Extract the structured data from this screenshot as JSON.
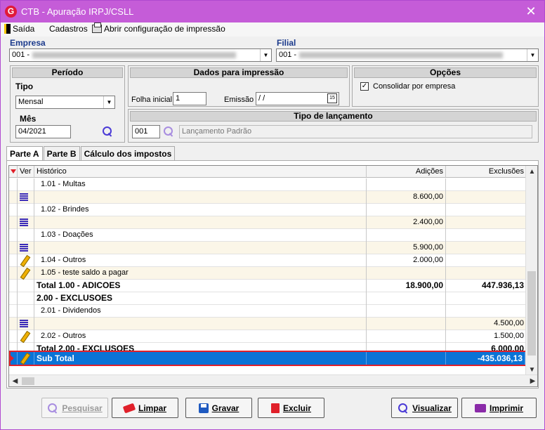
{
  "window": {
    "title": "CTB - Apuração IRPJ/CSLL",
    "app_icon": "G",
    "close_glyph": "✕"
  },
  "menu": {
    "exit": "Saída",
    "registrations": "Cadastros",
    "print_config": "Abrir configuração de impressão"
  },
  "company": {
    "label": "Empresa",
    "value": "001 -"
  },
  "branch": {
    "label": "Filial",
    "value": "001 -"
  },
  "period": {
    "header": "Período",
    "type_label": "Tipo",
    "type_value": "Mensal",
    "month_label": "Mês",
    "month_value": "04/2021"
  },
  "print_data": {
    "header": "Dados para impressão",
    "initial_sheet_label": "Folha inicial",
    "initial_sheet_value": "1",
    "issue_label": "Emissão",
    "issue_value": " / /",
    "calendar_glyph": "15"
  },
  "options": {
    "header": "Opções",
    "consolidate_label": "Consolidar por empresa",
    "consolidate_checked": true,
    "check_glyph": "✓"
  },
  "entry_type": {
    "header": "Tipo de lançamento",
    "code": "001",
    "description": "Lançamento Padrão"
  },
  "tabs": [
    {
      "label": "Parte A",
      "active": true
    },
    {
      "label": "Parte B",
      "active": false
    },
    {
      "label": "Cálculo dos impostos",
      "active": false
    }
  ],
  "grid": {
    "columns": {
      "view": "Ver",
      "history": "Histórico",
      "additions": "Adições",
      "exclusions": "Exclusões"
    },
    "rows": [
      {
        "icon": "",
        "history": "1.01 - Multas",
        "additions": "",
        "exclusions": "",
        "style": "normal"
      },
      {
        "icon": "list-icon",
        "history": "",
        "additions": "8.600,00",
        "exclusions": "",
        "style": "alt"
      },
      {
        "icon": "",
        "history": "1.02 - Brindes",
        "additions": "",
        "exclusions": "",
        "style": "normal"
      },
      {
        "icon": "list-icon",
        "history": "",
        "additions": "2.400,00",
        "exclusions": "",
        "style": "alt"
      },
      {
        "icon": "",
        "history": "1.03 - Doações",
        "additions": "",
        "exclusions": "",
        "style": "normal"
      },
      {
        "icon": "list-icon",
        "history": "",
        "additions": "5.900,00",
        "exclusions": "",
        "style": "alt"
      },
      {
        "icon": "pencil-icon",
        "history": "1.04 - Outros",
        "additions": "2.000,00",
        "exclusions": "",
        "style": "normal"
      },
      {
        "icon": "pencil-icon",
        "history": "1.05 - teste saldo a pagar",
        "additions": "",
        "exclusions": "",
        "style": "alt"
      },
      {
        "icon": "",
        "history": "Total 1.00 - ADICOES",
        "additions": "18.900,00",
        "exclusions": "447.936,13",
        "style": "total"
      },
      {
        "icon": "",
        "history": "2.00 - EXCLUSOES",
        "additions": "",
        "exclusions": "",
        "style": "header"
      },
      {
        "icon": "",
        "history": "2.01 - Dividendos",
        "additions": "",
        "exclusions": "",
        "style": "normal"
      },
      {
        "icon": "list-icon",
        "history": "",
        "additions": "",
        "exclusions": "4.500,00",
        "style": "alt"
      },
      {
        "icon": "pencil-icon",
        "history": "2.02 - Outros",
        "additions": "",
        "exclusions": "1.500,00",
        "style": "normal"
      },
      {
        "icon": "",
        "history": "Total 2.00 - EXCLUSOES",
        "additions": "",
        "exclusions": "6.000,00",
        "style": "total"
      }
    ],
    "subtotal": {
      "history": "Sub Total",
      "additions": "",
      "exclusions": "-435.036,13"
    }
  },
  "buttons": {
    "search": "Pesquisar",
    "clear": "Limpar",
    "save": "Gravar",
    "delete": "Excluir",
    "view": "Visualizar",
    "print": "Imprimir"
  },
  "colors": {
    "titlebar": "#c55cd8",
    "selection": "#0a73d6",
    "highlight_border": "#e0202a",
    "label_blue": "#1b3a8c"
  }
}
